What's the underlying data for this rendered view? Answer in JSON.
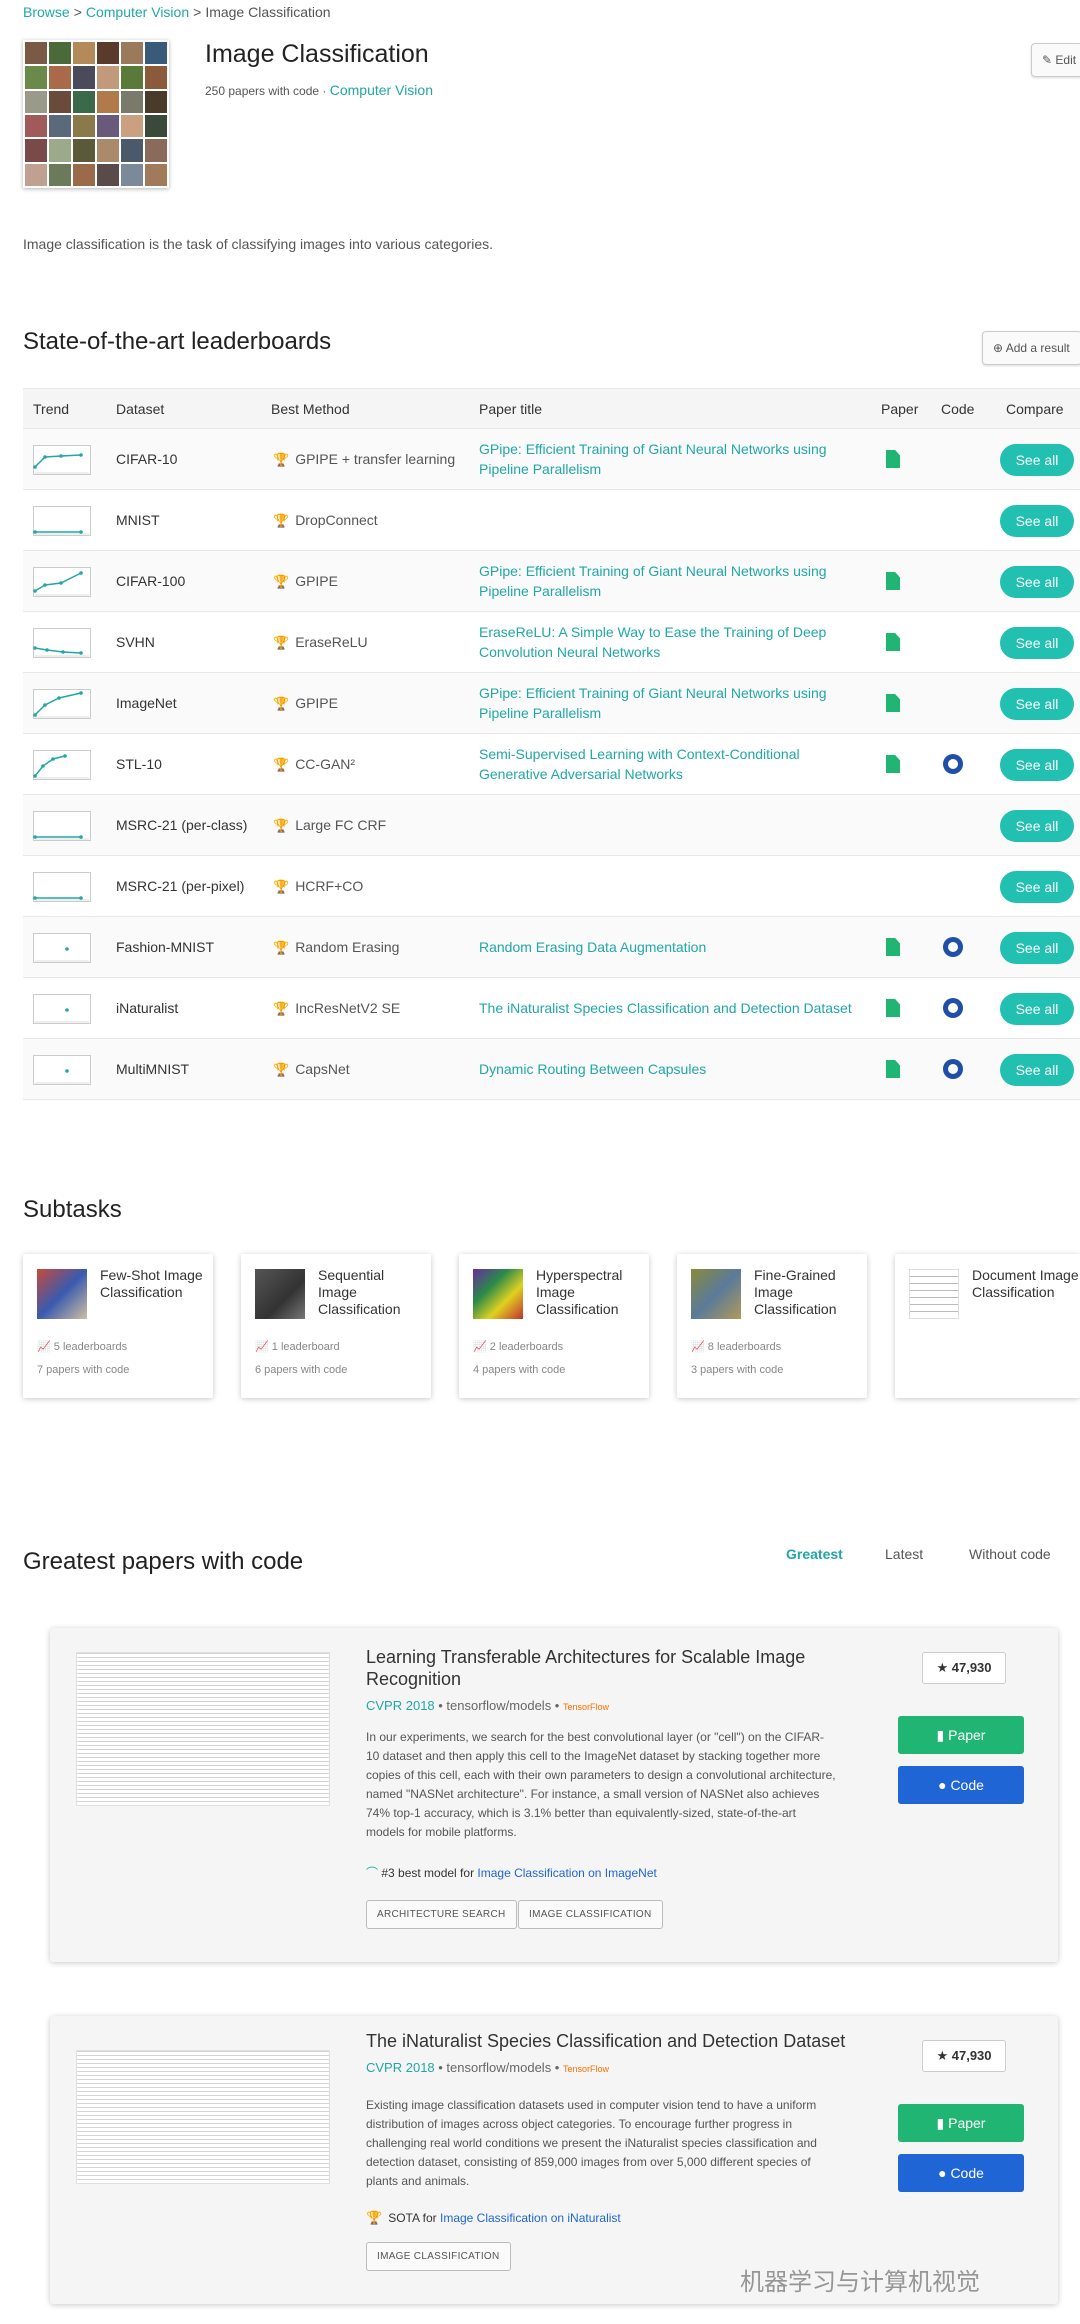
{
  "breadcrumb": {
    "items": [
      "Browse",
      "Computer Vision",
      "Image Classification"
    ],
    "sep": ">"
  },
  "header": {
    "title": "Image Classification",
    "papers_count": "250 papers with code",
    "dot": " · ",
    "area": "Computer Vision",
    "edit_label": "✎ Edit"
  },
  "description": "Image classification is the task of classifying images into various categories.",
  "leaderboards": {
    "title": "State-of-the-art leaderboards",
    "add_result": "⊕ Add a result",
    "columns": [
      "Trend",
      "Dataset",
      "Best Method",
      "Paper title",
      "Paper",
      "Code",
      "Compare"
    ],
    "see_all": "See all",
    "rows": [
      {
        "dataset": "CIFAR-10",
        "method": "GPIPE + transfer learning",
        "paper": "GPipe: Efficient Training of Giant Neural Networks using Pipeline Parallelism",
        "has_paper": true,
        "has_code": false
      },
      {
        "dataset": "MNIST",
        "method": "DropConnect",
        "paper": "",
        "has_paper": false,
        "has_code": false
      },
      {
        "dataset": "CIFAR-100",
        "method": "GPIPE",
        "paper": "GPipe: Efficient Training of Giant Neural Networks using Pipeline Parallelism",
        "has_paper": true,
        "has_code": false
      },
      {
        "dataset": "SVHN",
        "method": "EraseReLU",
        "paper": "EraseReLU: A Simple Way to Ease the Training of Deep Convolution Neural Networks",
        "has_paper": true,
        "has_code": false
      },
      {
        "dataset": "ImageNet",
        "method": "GPIPE",
        "paper": "GPipe: Efficient Training of Giant Neural Networks using Pipeline Parallelism",
        "has_paper": true,
        "has_code": false
      },
      {
        "dataset": "STL-10",
        "method": "CC-GAN²",
        "paper": "Semi-Supervised Learning with Context-Conditional Generative Adversarial Networks",
        "has_paper": true,
        "has_code": true
      },
      {
        "dataset": "MSRC-21 (per-class)",
        "method": "Large FC CRF",
        "paper": "",
        "has_paper": false,
        "has_code": false
      },
      {
        "dataset": "MSRC-21 (per-pixel)",
        "method": "HCRF+CO",
        "paper": "",
        "has_paper": false,
        "has_code": false
      },
      {
        "dataset": "Fashion-MNIST",
        "method": "Random Erasing",
        "paper": "Random Erasing Data Augmentation",
        "has_paper": true,
        "has_code": true
      },
      {
        "dataset": "iNaturalist",
        "method": "IncResNetV2 SE",
        "paper": "The iNaturalist Species Classification and Detection Dataset",
        "has_paper": true,
        "has_code": true
      },
      {
        "dataset": "MultiMNIST",
        "method": "CapsNet",
        "paper": "Dynamic Routing Between Capsules",
        "has_paper": true,
        "has_code": true
      }
    ]
  },
  "subtasks": {
    "title": "Subtasks",
    "items": [
      {
        "name": "Few-Shot Image Classification",
        "leaderboards": "5 leaderboards",
        "papers": "7 papers with code"
      },
      {
        "name": "Sequential Image Classification",
        "leaderboards": "1 leaderboard",
        "papers": "6 papers with code"
      },
      {
        "name": "Hyperspectral Image Classification",
        "leaderboards": "2 leaderboards",
        "papers": "4 papers with code"
      },
      {
        "name": "Fine-Grained Image Classification",
        "leaderboards": "8 leaderboards",
        "papers": "3 papers with code"
      },
      {
        "name": "Document Image Classification",
        "leaderboards": "",
        "papers": ""
      }
    ]
  },
  "greatest": {
    "title": "Greatest papers with code",
    "tabs": [
      "Greatest",
      "Latest",
      "Without code"
    ],
    "active_tab": "Greatest",
    "papers": [
      {
        "title": "Learning Transferable Architectures for Scalable Image Recognition",
        "venue": "CVPR 2018",
        "repo": " • tensorflow/models • ",
        "framework": "TensorFlow",
        "abstract": "In our experiments, we search for the best convolutional layer (or \"cell\") on the CIFAR-10 dataset and then apply this cell to the ImageNet dataset by stacking together more copies of this cell, each with their own parameters to design a convolutional architecture, named \"NASNet architecture\". For instance, a small version of NASNet also achieves 74% top-1 accuracy, which is 3.1% better than equivalently-sized, state-of-the-art models for mobile platforms.",
        "rank_prefix": "#3 best model for ",
        "rank_link": "Image Classification on ImageNet",
        "tags": [
          "ARCHITECTURE SEARCH",
          "IMAGE CLASSIFICATION"
        ],
        "stars": "★ 47,930",
        "paper_btn": "Paper",
        "code_btn": "Code"
      },
      {
        "title": "The iNaturalist Species Classification and Detection Dataset",
        "venue": "CVPR 2018",
        "repo": " • tensorflow/models • ",
        "framework": "TensorFlow",
        "abstract": "Existing image classification datasets used in computer vision tend to have a uniform distribution of images across object categories. To encourage further progress in challenging real world conditions we present the iNaturalist species classification and detection dataset, consisting of 859,000 images from over 5,000 different species of plants and animals.",
        "rank_prefix": "SOTA for ",
        "rank_link": "Image Classification on iNaturalist",
        "tags": [
          "IMAGE CLASSIFICATION"
        ],
        "stars": "★ 47,930",
        "paper_btn": "Paper",
        "code_btn": "Code"
      }
    ]
  },
  "watermark": "机器学习与计算机视觉",
  "colors": {
    "accent": "#21a7a7",
    "see_all": "#21c0b0",
    "paper_green": "#21b573",
    "code_blue": "#1f65d6",
    "trophy": "#e6a817"
  }
}
